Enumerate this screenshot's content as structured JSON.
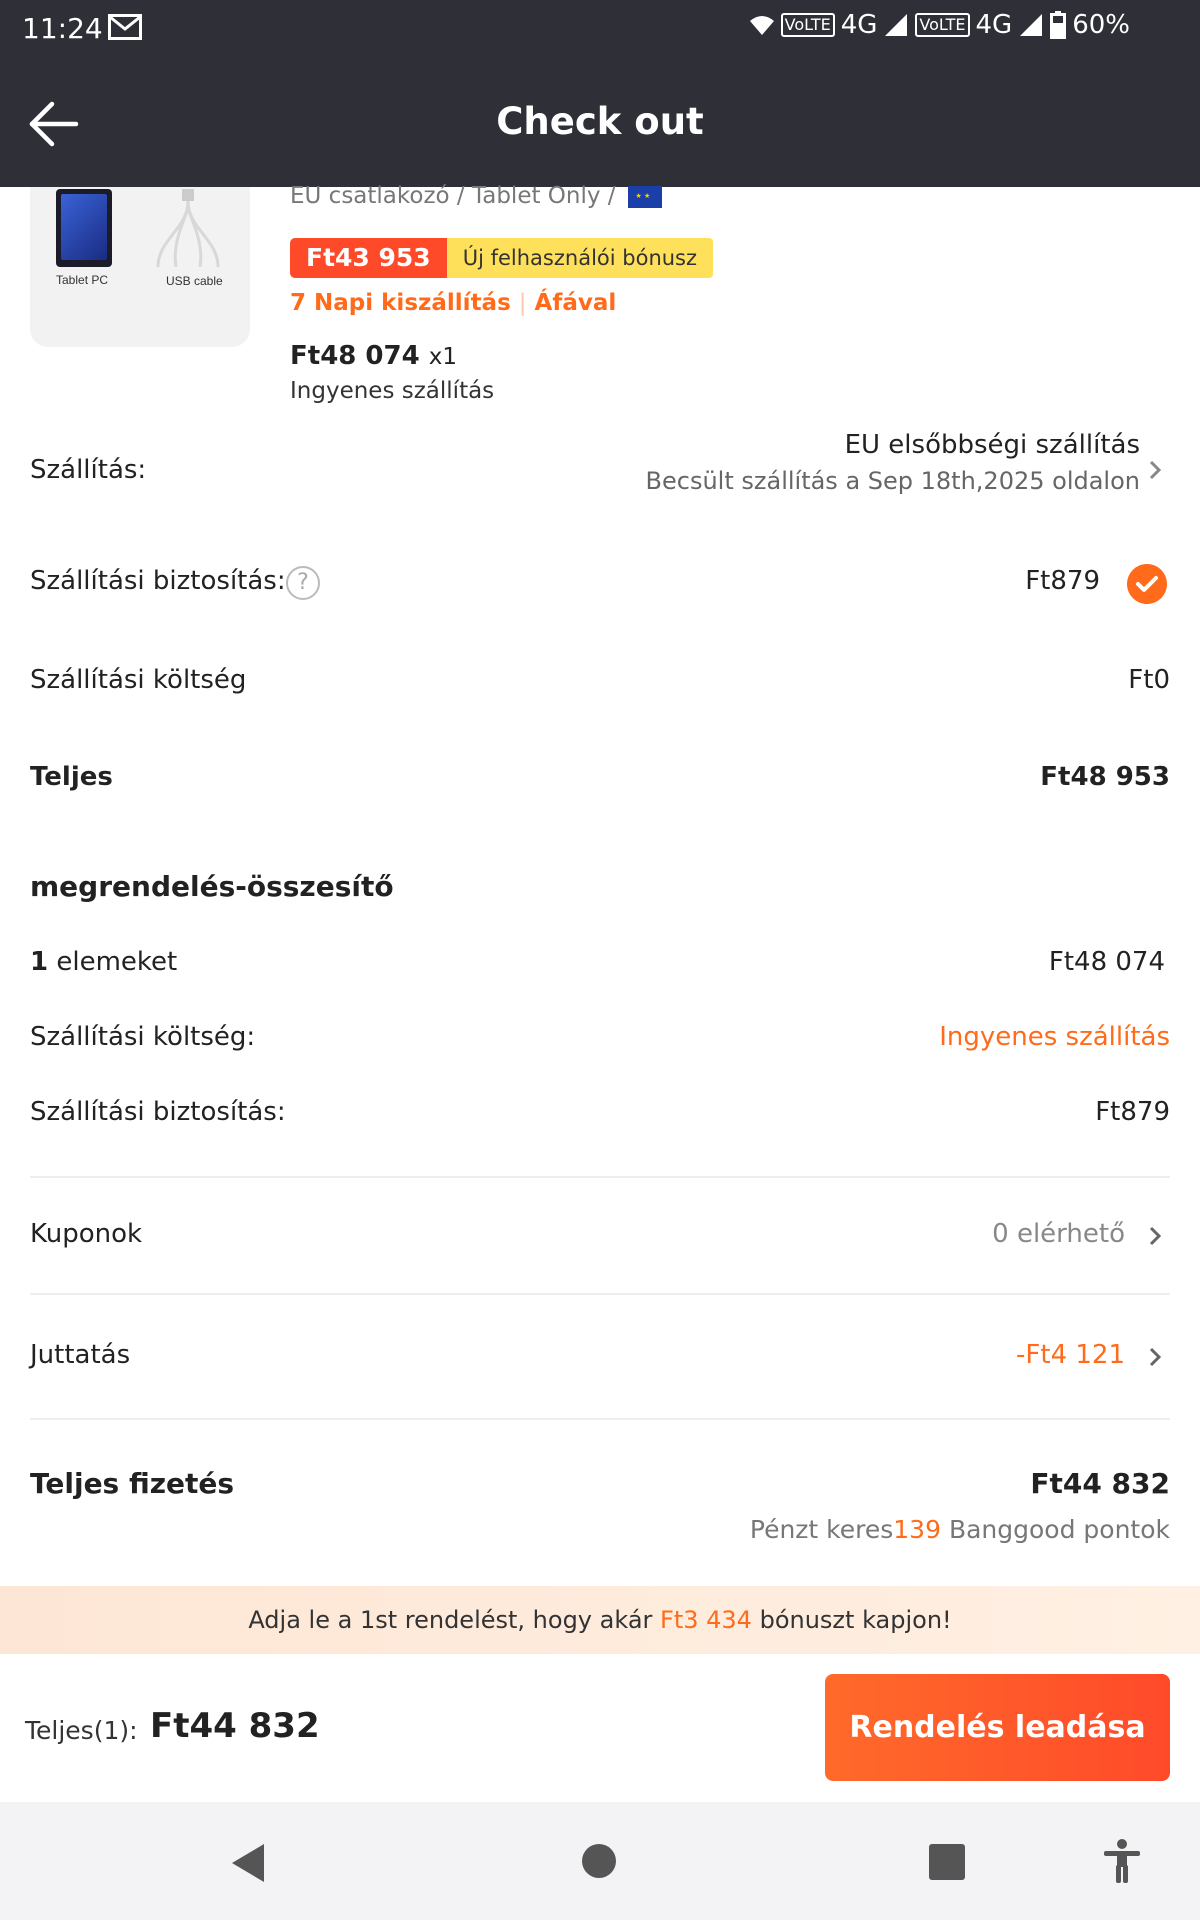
{
  "status_bar": {
    "time": "11:24",
    "network_1": "VoLTE",
    "network_1_type": "4G",
    "network_2": "VoLTE",
    "network_2_type": "4G",
    "battery": "60%"
  },
  "app_bar": {
    "title": "Check out",
    "back_icon": "arrow-left-icon"
  },
  "product": {
    "image_labels": [
      "Tablet PC",
      "USB cable"
    ],
    "variant": "EU csatlakozó / Tablet Only /",
    "sale_price": "Ft43 953",
    "bonus_label": "Új felhasználói bónusz",
    "delivery_tag": "7 Napi kiszállítás",
    "vat_tag": "Áfával",
    "unit_price": "Ft48 074",
    "quantity": "x1",
    "shipping_note": "Ingyenes szállítás"
  },
  "shipping": {
    "label": "Szállítás:",
    "method": "EU elsőbbségi szállítás",
    "estimate": "Becsült szállítás a Sep 18th,2025 oldalon"
  },
  "insurance": {
    "label": "Szállítási biztosítás:",
    "help_icon": "question-circle-icon",
    "value": "Ft879",
    "checked": true
  },
  "shipping_cost": {
    "label": "Szállítási költség",
    "value": "Ft0"
  },
  "total": {
    "label": "Teljes",
    "value": "Ft48 953"
  },
  "summary": {
    "title": "megrendelés-összesítő",
    "items_count": "1",
    "items_label": "elemeket",
    "items_value": "Ft48 074",
    "shipping_label": "Szállítási költség:",
    "shipping_value": "Ingyenes szállítás",
    "insurance_label": "Szállítási biztosítás:",
    "insurance_value": "Ft879"
  },
  "coupons": {
    "label": "Kuponok",
    "value": "0 elérhető"
  },
  "benefit": {
    "label": "Juttatás",
    "value": "-Ft4 121"
  },
  "payment": {
    "label": "Teljes fizetés",
    "value": "Ft44 832",
    "points_prefix": "Pénzt keres",
    "points_value": "139",
    "points_suffix": " Banggood pontok"
  },
  "banner": {
    "prefix": "Adja le a 1st rendelést, hogy akár ",
    "amount": "Ft3 434",
    "suffix": " bónuszt kapjon!"
  },
  "bottom_bar": {
    "total_label": "Teljes(1):",
    "total_value": "Ft44 832",
    "order_button": "Rendelés leadása"
  },
  "colors": {
    "accent": "#ff6b1a",
    "price_red": "#ff4a2a",
    "bonus_yellow": "#ffe05a",
    "header_bg": "#2f3037"
  }
}
